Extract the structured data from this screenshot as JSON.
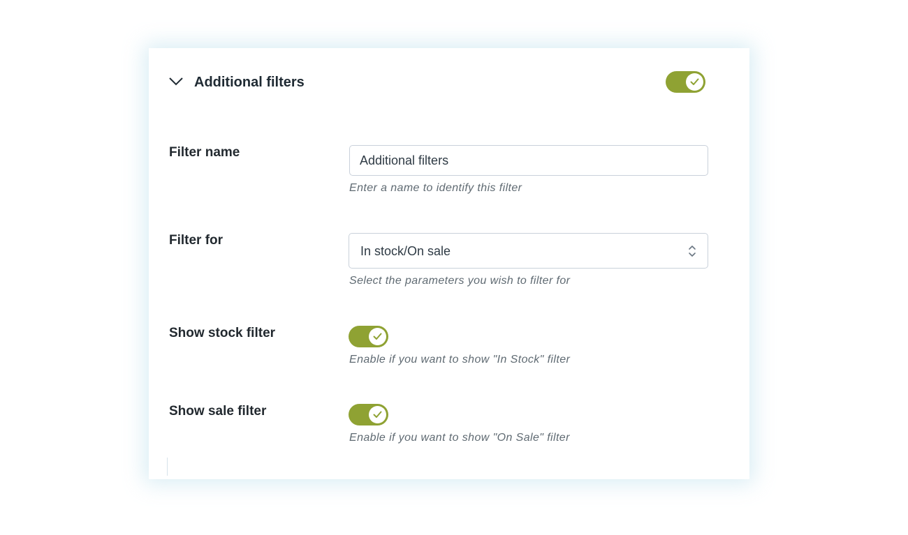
{
  "section": {
    "title": "Additional filters",
    "enabled": true
  },
  "filter_name": {
    "label": "Filter name",
    "value": "Additional filters",
    "help": "Enter a name to identify this filter"
  },
  "filter_for": {
    "label": "Filter for",
    "selected": "In stock/On sale",
    "help": "Select the parameters you wish to filter for"
  },
  "show_stock_filter": {
    "label": "Show stock filter",
    "enabled": true,
    "help": "Enable if you want to show \"In Stock\" filter"
  },
  "show_sale_filter": {
    "label": "Show sale filter",
    "enabled": true,
    "help": "Enable if you want to show \"On Sale\" filter"
  },
  "icons": {
    "collapse": "chevron-down-icon",
    "toggle_on": "check-icon",
    "select": "chevron-up-down-icon"
  },
  "colors": {
    "toggle_on": "#8fa233",
    "text_dark": "#1f2a33",
    "help_text": "#5f6a72",
    "input_border": "#c9d1da"
  }
}
